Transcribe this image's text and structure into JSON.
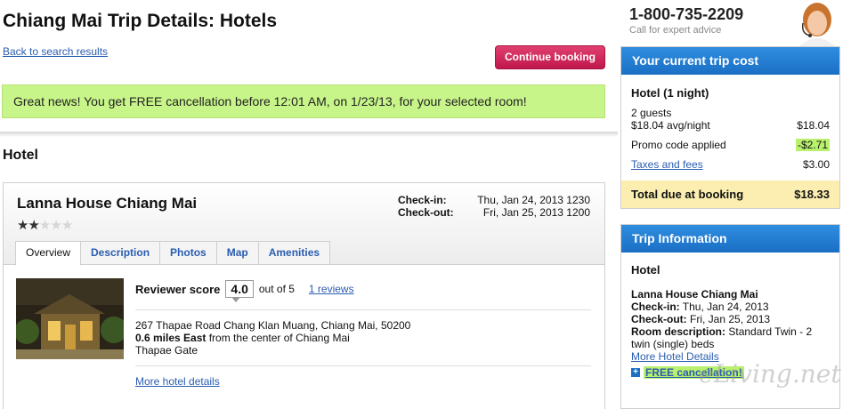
{
  "header": {
    "title": "Chiang Mai Trip Details: Hotels",
    "back_link": "Back to search results",
    "continue_label": "Continue booking"
  },
  "banner": {
    "text": "Great news! You get FREE cancellation before 12:01 AM, on 1/23/13, for your selected room!"
  },
  "section_title": "Hotel",
  "hotel": {
    "name": "Lanna House Chiang Mai",
    "stars": 2,
    "stars_max": 5,
    "checkin_label": "Check-in:",
    "checkin_value": "Thu, Jan 24, 2013 1230",
    "checkout_label": "Check-out:",
    "checkout_value": "Fri, Jan 25, 2013 1200",
    "tabs": [
      "Overview",
      "Description",
      "Photos",
      "Map",
      "Amenities"
    ],
    "active_tab": "Overview",
    "reviewer_label": "Reviewer score",
    "reviewer_score": "4.0",
    "out_of": "out of 5",
    "reviews_link": "1 reviews",
    "address_line1": "267 Thapae Road Chang Klan Muang, Chiang Mai, 50200",
    "distance_bold": "0.6 miles East",
    "distance_rest": " from the center of Chiang Mai",
    "area": "Thapae Gate",
    "more_details": "More hotel details"
  },
  "contact": {
    "phone": "1-800-735-2209",
    "subtext": "Call for expert advice"
  },
  "cost": {
    "header": "Your current trip cost",
    "title": "Hotel (1 night)",
    "guests": "2 guests",
    "avg_label": "$18.04 avg/night",
    "avg_value": "$18.04",
    "promo_label": "Promo code applied",
    "promo_value": "-$2.71",
    "taxes_label": "Taxes and fees",
    "taxes_value": "$3.00",
    "total_label": "Total due at booking",
    "total_value": "$18.33"
  },
  "trip_info": {
    "header": "Trip Information",
    "title": "Hotel",
    "hotel_name": "Lanna House Chiang Mai",
    "checkin_label": "Check-in:",
    "checkin_value": " Thu, Jan 24, 2013",
    "checkout_label": "Check-out:",
    "checkout_value": " Fri, Jan 25, 2013",
    "room_label": "Room description:",
    "room_value": " Standard Twin - 2 twin (single) beds",
    "more_link": "More Hotel Details",
    "free_cancel": "FREE cancellation!"
  },
  "watermark": "eLiving.net",
  "colors": {
    "accent_blue": "#1a6fc4",
    "continue_red": "#c0174d",
    "banner_green": "#c8f589",
    "total_yellow": "#fbeeb0"
  }
}
